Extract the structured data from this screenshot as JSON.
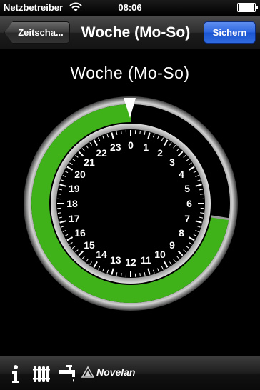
{
  "status_bar": {
    "carrier": "Netzbetreiber",
    "time": "08:06"
  },
  "nav_bar": {
    "back_label": "Zeitscha...",
    "title": "Woche (Mo-So)",
    "save_label": "Sichern"
  },
  "dial": {
    "heading": "Woche (Mo-So)",
    "hour_labels": [
      "0",
      "1",
      "2",
      "3",
      "4",
      "5",
      "6",
      "7",
      "8",
      "9",
      "10",
      "11",
      "12",
      "13",
      "14",
      "15",
      "16",
      "17",
      "18",
      "19",
      "20",
      "21",
      "22",
      "23"
    ],
    "active_color": "#3fb21a",
    "inactive_color": "#000000",
    "active_from_hour": 6.6,
    "active_to_hour": 24,
    "current_hour": 6.6
  },
  "toolbar": {
    "icons": [
      "info-icon",
      "heater-icon",
      "tap-icon"
    ],
    "brand_name": "Novelan"
  }
}
